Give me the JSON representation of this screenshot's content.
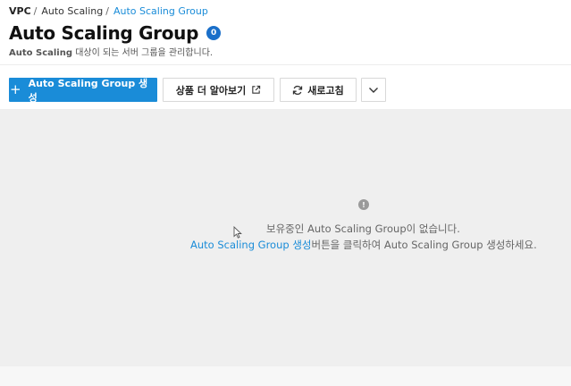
{
  "breadcrumb": {
    "root": "VPC",
    "parent": "Auto Scaling",
    "current": "Auto Scaling Group",
    "separator": "/"
  },
  "header": {
    "title": "Auto Scaling Group",
    "count": "0",
    "subtitle_strong": "Auto Scaling",
    "subtitle_rest": " 대상이 되는 서버 그룹을 관리합니다."
  },
  "toolbar": {
    "create_plus": "+",
    "create_label": "Auto Scaling Group 생성",
    "learn_more_label": "상품 더 알아보기",
    "refresh_label": "새로고침"
  },
  "empty_state": {
    "info_glyph": "!",
    "line1": "보유중인 Auto Scaling Group이 없습니다.",
    "line2_link": "Auto Scaling Group 생성",
    "line2_rest": "버튼을 클릭하여 Auto Scaling Group 생성하세요."
  },
  "colors": {
    "accent": "#1a8cd8",
    "badge": "#1a6fc9",
    "content_bg": "#efefef"
  }
}
